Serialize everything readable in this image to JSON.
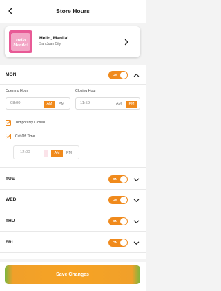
{
  "header": {
    "title": "Store Hours",
    "back_icon": "chevron-left-icon"
  },
  "store": {
    "logo_text": "Hello Manila!",
    "name": "Hello, Manila!",
    "city": "San Juan City"
  },
  "days": {
    "mon": {
      "label": "MON",
      "toggle": "ON",
      "enabled": true,
      "expanded": true
    },
    "tue": {
      "label": "TUE",
      "toggle": "ON",
      "enabled": true,
      "expanded": false
    },
    "wed": {
      "label": "WED",
      "toggle": "ON",
      "enabled": true,
      "expanded": false
    },
    "thu": {
      "label": "THU",
      "toggle": "ON",
      "enabled": true,
      "expanded": false
    },
    "fri": {
      "label": "FRI",
      "toggle": "ON",
      "enabled": true,
      "expanded": false
    }
  },
  "monday_detail": {
    "opening_label": "Opening Hour",
    "opening_time": "08:00",
    "opening_am": "AM",
    "opening_pm": "PM",
    "opening_selected": "AM",
    "closing_label": "Closing Hour",
    "closing_time": "11:59",
    "closing_am": "AM",
    "closing_pm": "PM",
    "closing_selected": "PM",
    "temporarily_closed_label": "Temporarily Closed",
    "temporarily_closed_checked": true,
    "cutoff_label": "Cut-Off Time",
    "cutoff_checked": true,
    "cutoff_time": "12:00",
    "cutoff_am": "AM",
    "cutoff_pm": "PM",
    "cutoff_selected": "AM"
  },
  "footer": {
    "save_label": "Save Changes"
  },
  "colors": {
    "accent": "#f08a1c",
    "logo_bg": "#e85a96"
  }
}
